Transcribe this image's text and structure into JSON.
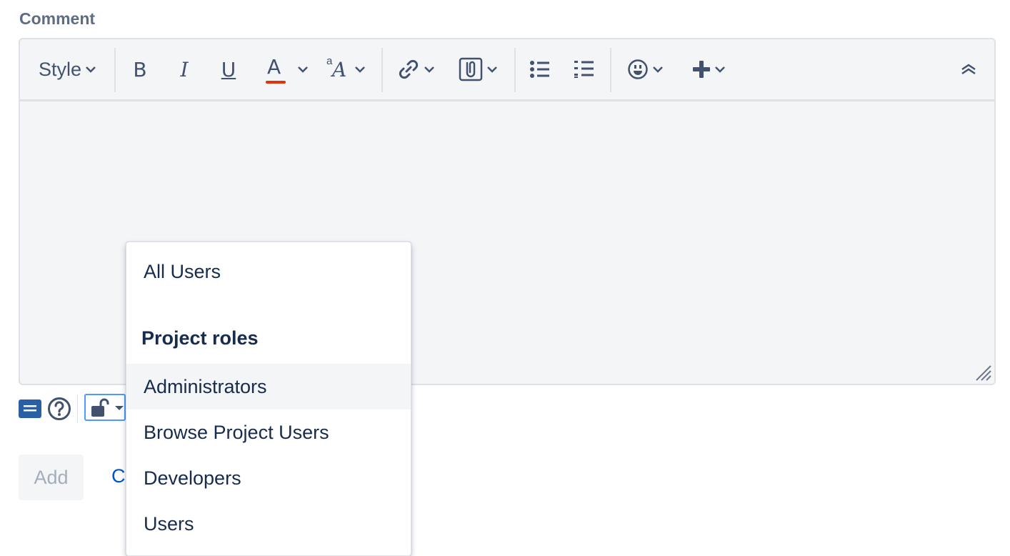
{
  "comment_label": "Comment",
  "toolbar": {
    "style_label": "Style",
    "bold": "B",
    "italic": "I",
    "underline": "U",
    "text_color": "A",
    "text_color_accent": "#de350b",
    "text_effects_small": "a",
    "text_effects_large": "A"
  },
  "security_dropdown": {
    "all_users": "All Users",
    "heading": "Project roles",
    "roles": [
      "Administrators",
      "Browse Project Users",
      "Developers",
      "Users"
    ]
  },
  "actions": {
    "add_label": "Add",
    "cancel_label": "C"
  },
  "colors": {
    "editor_background": "#f4f5f7",
    "icon": "#42526e",
    "focus_border": "#4c9aff",
    "link": "#0052cc"
  }
}
